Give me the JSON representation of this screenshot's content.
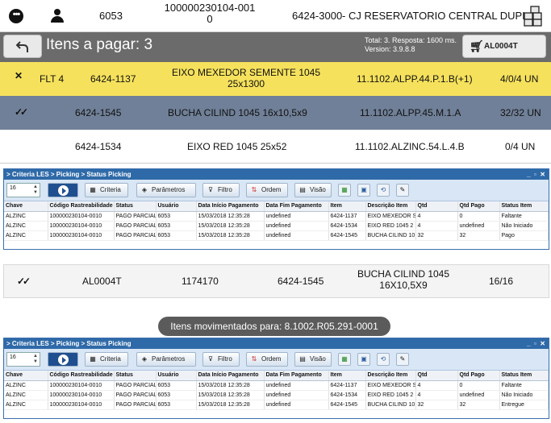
{
  "header": {
    "user_code": "6053",
    "tracking_line1": "100000230104-001",
    "tracking_line2": "0",
    "code": "6424-3000",
    "location": "- CJ RESERVATORIO CENTRAL DUPLO",
    "menu_icon": "more-dots-icon",
    "user_icon": "user-icon",
    "box_icon": "boxes-icon"
  },
  "action_bar": {
    "back_icon": "back-arrow-icon",
    "title": "Itens a pagar: 3",
    "info_line1": "Total: 3. Resposta: 1600 ms.",
    "info_line2": "Version: 3.9.8.8",
    "cart_label": "AL0004T",
    "cart_icon": "cart-icon"
  },
  "items": [
    {
      "status_icon": "x-mark-icon",
      "flag": "FLT 4",
      "code": "6424-1137",
      "desc_line1": "EIXO MEXEDOR SEMENTE 1045",
      "desc_line2": "25x1300",
      "address": "11.1102.ALPP.44.P.1.B(+1)",
      "qty": "4/0/4 UN",
      "bg": "#f5e15c"
    },
    {
      "status_icon": "double-check-icon",
      "flag": "",
      "code": "6424-1545",
      "desc_line1": "BUCHA CILIND 1045 16x10,5x9",
      "desc_line2": "",
      "address": "11.1102.ALPP.45.M.1.A",
      "qty": "32/32 UN",
      "bg": "#708098"
    },
    {
      "status_icon": "",
      "flag": "",
      "code": "6424-1534",
      "desc_line1": "EIXO RED 1045 25x52",
      "desc_line2": "",
      "address": "11.1102.ALZINC.54.L.4.B",
      "qty": "0/4 UN",
      "bg": "#ffffff"
    }
  ],
  "panel1": {
    "breadcrumb": "> Criteria LES > Picking > Status Picking",
    "page_size": "16",
    "buttons": [
      "Criteria",
      "Parâmetros",
      "Filtro",
      "Ordem",
      "Visão"
    ],
    "columns": [
      "Chave",
      "Código Rastreabilidade",
      "Status",
      "Usuário",
      "Data Início Pagamento",
      "Data Fim Pagamento",
      "Item",
      "Descrição Item",
      "Qtd",
      "Qtd Pago",
      "Status Item"
    ],
    "rows": [
      [
        "ALZINC",
        "100000230104-0010",
        "PAGO PARCIAL",
        "6053",
        "15/03/2018 12:35:28",
        "undefined",
        "6424-1137",
        "EIXO MEXEDOR S",
        "4",
        "0",
        "Faltante"
      ],
      [
        "ALZINC",
        "100000230104-0010",
        "PAGO PARCIAL",
        "6053",
        "15/03/2018 12:35:28",
        "undefined",
        "6424-1534",
        "EIXO RED 1045 2",
        "4",
        "undefined",
        "Não Iniciado"
      ],
      [
        "ALZINC",
        "100000230104-0010",
        "PAGO PARCIAL",
        "6053",
        "15/03/2018 12:35:28",
        "undefined",
        "6424-1545",
        "BUCHA CILIND 10",
        "32",
        "32",
        "Pago"
      ]
    ]
  },
  "bottom_item": {
    "status_icon": "double-check-icon",
    "cart": "AL0004T",
    "number": "1174170",
    "code": "6424-1545",
    "desc_line1": "BUCHA CILIND 1045",
    "desc_line2": "16X10,5X9",
    "qty": "16/16"
  },
  "toast": "Itens movimentados para: 8.1002.R05.291-0001",
  "panel2": {
    "breadcrumb": "> Criteria LES > Picking > Status Picking",
    "page_size": "16",
    "buttons": [
      "Criteria",
      "Parâmetros",
      "Filtro",
      "Ordem",
      "Visão"
    ],
    "columns": [
      "Chave",
      "Código Rastreabilidade",
      "Status",
      "Usuário",
      "Data Início Pagamento",
      "Data Fim Pagamento",
      "Item",
      "Descrição Item",
      "Qtd",
      "Qtd Pago",
      "Status Item"
    ],
    "rows": [
      [
        "ALZINC",
        "100000230104-0010",
        "PAGO PARCIAL",
        "6053",
        "15/03/2018 12:35:28",
        "undefined",
        "6424-1137",
        "EIXO MEXEDOR S",
        "4",
        "0",
        "Faltante"
      ],
      [
        "ALZINC",
        "100000230104-0010",
        "PAGO PARCIAL",
        "6053",
        "15/03/2018 12:35:28",
        "undefined",
        "6424-1534",
        "EIXO RED 1045 2",
        "4",
        "undefined",
        "Não Iniciado"
      ],
      [
        "ALZINC",
        "100000230104-0010",
        "PAGO PARCIAL",
        "6053",
        "15/03/2018 12:35:28",
        "undefined",
        "6424-1545",
        "BUCHA CILIND 10",
        "32",
        "32",
        "Entregue"
      ]
    ]
  }
}
